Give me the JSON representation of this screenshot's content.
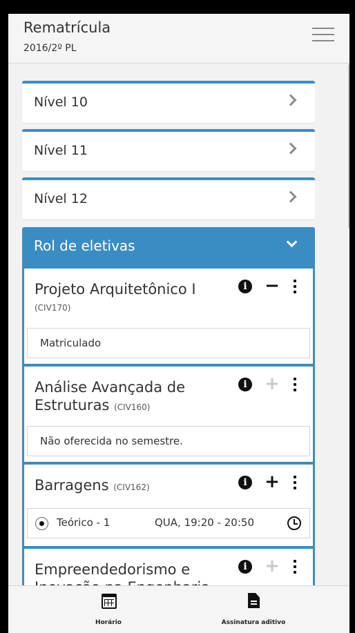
{
  "header": {
    "title": "Rematrícula",
    "subtitle": "2016/2º PL"
  },
  "levels": [
    {
      "label": "Nível 10"
    },
    {
      "label": "Nível 11"
    },
    {
      "label": "Nível 12"
    }
  ],
  "electives": {
    "title": "Rol de eletivas",
    "courses": [
      {
        "name": "Projeto Arquitetônico I",
        "code": "(CIV170)",
        "action_icon": "minus-icon",
        "status": "Matriculado"
      },
      {
        "name_line1": "Análise Avançada de",
        "name_line2": "Estruturas",
        "code": "(CIV160)",
        "action_icon": "plus-icon-disabled",
        "status": "Não oferecida no semestre."
      },
      {
        "name": "Barragens",
        "code": "(CIV162)",
        "action_icon": "plus-icon",
        "class_label": "Teórico - 1",
        "schedule": "QUA, 19:20 - 20:50"
      },
      {
        "name_line1": "Empreendedorismo e",
        "name_line2": "Inovação na Engenharia",
        "action_icon": "plus-icon-disabled"
      }
    ]
  },
  "bottom_nav": {
    "schedule_label": "Horário",
    "addendum_label": "Assinatura aditivo"
  },
  "colors": {
    "accent": "#3a8dc2",
    "background": "#f2f2f2",
    "disabled_icon": "#c8c8c8"
  }
}
